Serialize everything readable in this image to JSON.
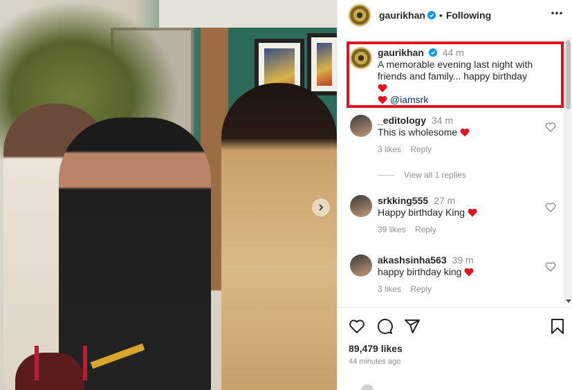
{
  "post": {
    "author": "gaurikhan",
    "follow_status": "Following",
    "separator": "•",
    "caption": {
      "username": "gaurikhan",
      "time": "44 m",
      "text": "A memorable evening last night with friends and family... happy birthday",
      "mention": "@iamsrk"
    },
    "comments": [
      {
        "username": "_editology",
        "time": "34 m",
        "text": "This is wholesome",
        "likes": "3 likes",
        "reply": "Reply"
      },
      {
        "username": "srkking555",
        "time": "27 m",
        "text": "Happy birthday King",
        "likes": "39 likes",
        "reply": "Reply"
      },
      {
        "username": "akashsinha563",
        "time": "39 m",
        "text": "happy birthday king",
        "likes": "3 likes",
        "reply": "Reply"
      }
    ],
    "view_replies": "View all 1 replies",
    "likes_total": "89,479 likes",
    "posted_ago": "44 minutes ago"
  },
  "colors": {
    "heart": "#e0141e",
    "highlight_border": "#e0141e",
    "verified": "#0095f6",
    "mention": "#00376b",
    "muted": "#8e8e8e"
  },
  "icons": [
    "verified-badge-icon",
    "more-options-icon",
    "heart-icon",
    "comment-icon",
    "share-icon",
    "save-icon",
    "chevron-right-icon"
  ]
}
